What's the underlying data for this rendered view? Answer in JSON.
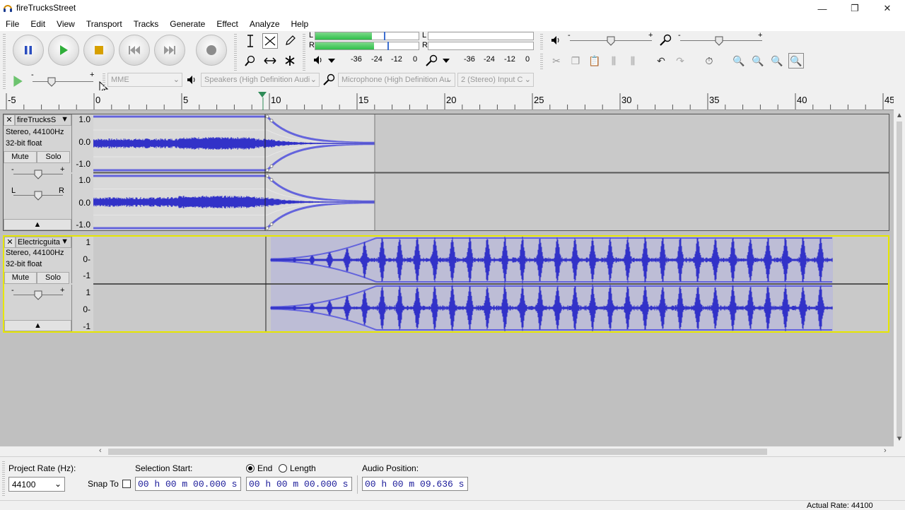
{
  "window": {
    "title": "fireTrucksStreet",
    "controls": [
      "—",
      "❐",
      "✕"
    ]
  },
  "menu": [
    "File",
    "Edit",
    "View",
    "Transport",
    "Tracks",
    "Generate",
    "Effect",
    "Analyze",
    "Help"
  ],
  "meters": {
    "playback_L": "L",
    "playback_R": "R",
    "record_L": "L",
    "record_R": "R",
    "playback_scale": [
      "-36",
      "-24",
      "-12",
      "0"
    ],
    "record_scale": [
      "-36",
      "-24",
      "-12",
      "0"
    ],
    "playback_level_L": 0.55,
    "playback_level_R": 0.57,
    "gain_minus": "-",
    "gain_plus": "+"
  },
  "devices": {
    "host": "MME",
    "output": "Speakers (High Definition Audi",
    "input": "Microphone (High Definition Au",
    "channels": "2 (Stereo) Input C"
  },
  "ruler": {
    "labels": [
      "-5",
      "0",
      "5",
      "10",
      "15",
      "20",
      "25",
      "30",
      "35",
      "40",
      "45"
    ],
    "playhead_seconds": 9.636
  },
  "tracks": [
    {
      "name": "fireTrucksS",
      "format": "Stereo, 44100Hz",
      "bitdepth": "32-bit float",
      "mute": "Mute",
      "solo": "Solo",
      "scale_top": [
        "1.0",
        "0.0",
        "-1.0"
      ],
      "scale_bottom": [
        "1.0",
        "0.0",
        "-1.0"
      ],
      "gain_minus": "-",
      "gain_plus": "+",
      "pan_left": "L",
      "pan_right": "R"
    },
    {
      "name": "Electricguita",
      "format": "Stereo, 44100Hz",
      "bitdepth": "32-bit float",
      "mute": "Mute",
      "solo": "Solo",
      "scale_top": [
        "1",
        "0-",
        "-1"
      ],
      "scale_bottom": [
        "1",
        "0-",
        "-1"
      ],
      "gain_minus": "-",
      "gain_plus": "+"
    }
  ],
  "selection": {
    "project_rate_label": "Project Rate (Hz):",
    "project_rate": "44100",
    "snap_to": "Snap To",
    "selection_start_label": "Selection Start:",
    "end_label": "End",
    "length_label": "Length",
    "audio_position_label": "Audio Position:",
    "selection_start": "00 h 00 m 00.000 s",
    "selection_end": "00 h 00 m 00.000 s",
    "audio_position": "00 h 00 m 09.636 s"
  },
  "status": {
    "actual_rate": "Actual Rate: 44100"
  },
  "colors": {
    "waveform": "#3232c8",
    "waveform_rms": "#6464dc",
    "track_bg": "#c9c9c9",
    "meter_green": "#2fbf4a",
    "selected_border": "#e6e600"
  }
}
